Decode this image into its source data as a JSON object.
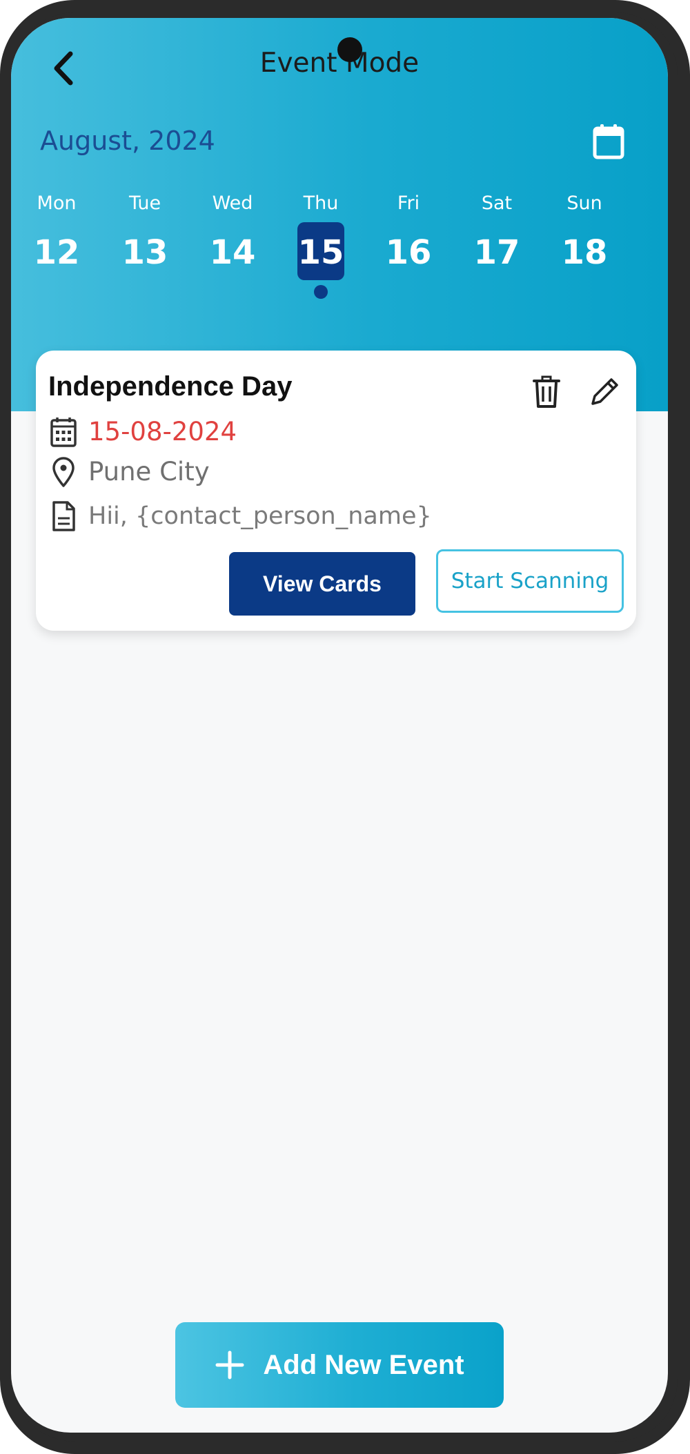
{
  "header": {
    "title": "Event Mode",
    "month": "August, 2024"
  },
  "week": [
    {
      "name": "Mon",
      "num": "12"
    },
    {
      "name": "Tue",
      "num": "13"
    },
    {
      "name": "Wed",
      "num": "14"
    },
    {
      "name": "Thu",
      "num": "15",
      "selected": true
    },
    {
      "name": "Fri",
      "num": "16"
    },
    {
      "name": "Sat",
      "num": "17"
    },
    {
      "name": "Sun",
      "num": "18"
    }
  ],
  "event": {
    "title": "Independence Day",
    "date": "15-08-2024",
    "location": "Pune City",
    "message": "Hii, {contact_person_name}",
    "view_cards_label": "View Cards",
    "start_scanning_label": "Start Scanning"
  },
  "footer": {
    "add_label": "Add New Event"
  },
  "icons": {
    "back": "chevron-left-icon",
    "calendar": "calendar-icon",
    "delete": "trash-icon",
    "edit": "pencil-icon",
    "date": "calendar-grid-icon",
    "location": "location-pin-icon",
    "message": "document-icon",
    "add": "plus-icon"
  },
  "colors": {
    "header_gradient_start": "#46bedd",
    "header_gradient_end": "#08a0c8",
    "primary_dark": "#0b3a86",
    "month_text": "#1b4d93",
    "date_red": "#e0413f",
    "accent_cyan": "#1aa2c8"
  }
}
